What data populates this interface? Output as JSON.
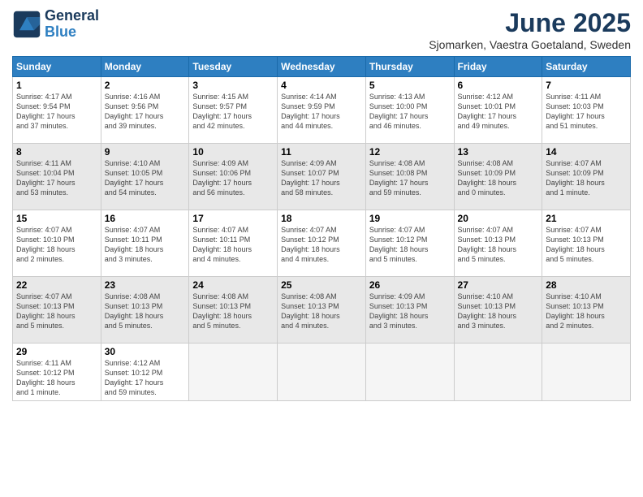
{
  "logo": {
    "line1": "General",
    "line2": "Blue"
  },
  "title": "June 2025",
  "subtitle": "Sjomarken, Vaestra Goetaland, Sweden",
  "days_of_week": [
    "Sunday",
    "Monday",
    "Tuesday",
    "Wednesday",
    "Thursday",
    "Friday",
    "Saturday"
  ],
  "weeks": [
    [
      {
        "day": "1",
        "info": "Sunrise: 4:17 AM\nSunset: 9:54 PM\nDaylight: 17 hours\nand 37 minutes.",
        "shaded": false
      },
      {
        "day": "2",
        "info": "Sunrise: 4:16 AM\nSunset: 9:56 PM\nDaylight: 17 hours\nand 39 minutes.",
        "shaded": false
      },
      {
        "day": "3",
        "info": "Sunrise: 4:15 AM\nSunset: 9:57 PM\nDaylight: 17 hours\nand 42 minutes.",
        "shaded": false
      },
      {
        "day": "4",
        "info": "Sunrise: 4:14 AM\nSunset: 9:59 PM\nDaylight: 17 hours\nand 44 minutes.",
        "shaded": false
      },
      {
        "day": "5",
        "info": "Sunrise: 4:13 AM\nSunset: 10:00 PM\nDaylight: 17 hours\nand 46 minutes.",
        "shaded": false
      },
      {
        "day": "6",
        "info": "Sunrise: 4:12 AM\nSunset: 10:01 PM\nDaylight: 17 hours\nand 49 minutes.",
        "shaded": false
      },
      {
        "day": "7",
        "info": "Sunrise: 4:11 AM\nSunset: 10:03 PM\nDaylight: 17 hours\nand 51 minutes.",
        "shaded": false
      }
    ],
    [
      {
        "day": "8",
        "info": "Sunrise: 4:11 AM\nSunset: 10:04 PM\nDaylight: 17 hours\nand 53 minutes.",
        "shaded": true
      },
      {
        "day": "9",
        "info": "Sunrise: 4:10 AM\nSunset: 10:05 PM\nDaylight: 17 hours\nand 54 minutes.",
        "shaded": true
      },
      {
        "day": "10",
        "info": "Sunrise: 4:09 AM\nSunset: 10:06 PM\nDaylight: 17 hours\nand 56 minutes.",
        "shaded": true
      },
      {
        "day": "11",
        "info": "Sunrise: 4:09 AM\nSunset: 10:07 PM\nDaylight: 17 hours\nand 58 minutes.",
        "shaded": true
      },
      {
        "day": "12",
        "info": "Sunrise: 4:08 AM\nSunset: 10:08 PM\nDaylight: 17 hours\nand 59 minutes.",
        "shaded": true
      },
      {
        "day": "13",
        "info": "Sunrise: 4:08 AM\nSunset: 10:09 PM\nDaylight: 18 hours\nand 0 minutes.",
        "shaded": true
      },
      {
        "day": "14",
        "info": "Sunrise: 4:07 AM\nSunset: 10:09 PM\nDaylight: 18 hours\nand 1 minute.",
        "shaded": true
      }
    ],
    [
      {
        "day": "15",
        "info": "Sunrise: 4:07 AM\nSunset: 10:10 PM\nDaylight: 18 hours\nand 2 minutes.",
        "shaded": false
      },
      {
        "day": "16",
        "info": "Sunrise: 4:07 AM\nSunset: 10:11 PM\nDaylight: 18 hours\nand 3 minutes.",
        "shaded": false
      },
      {
        "day": "17",
        "info": "Sunrise: 4:07 AM\nSunset: 10:11 PM\nDaylight: 18 hours\nand 4 minutes.",
        "shaded": false
      },
      {
        "day": "18",
        "info": "Sunrise: 4:07 AM\nSunset: 10:12 PM\nDaylight: 18 hours\nand 4 minutes.",
        "shaded": false
      },
      {
        "day": "19",
        "info": "Sunrise: 4:07 AM\nSunset: 10:12 PM\nDaylight: 18 hours\nand 5 minutes.",
        "shaded": false
      },
      {
        "day": "20",
        "info": "Sunrise: 4:07 AM\nSunset: 10:13 PM\nDaylight: 18 hours\nand 5 minutes.",
        "shaded": false
      },
      {
        "day": "21",
        "info": "Sunrise: 4:07 AM\nSunset: 10:13 PM\nDaylight: 18 hours\nand 5 minutes.",
        "shaded": false
      }
    ],
    [
      {
        "day": "22",
        "info": "Sunrise: 4:07 AM\nSunset: 10:13 PM\nDaylight: 18 hours\nand 5 minutes.",
        "shaded": true
      },
      {
        "day": "23",
        "info": "Sunrise: 4:08 AM\nSunset: 10:13 PM\nDaylight: 18 hours\nand 5 minutes.",
        "shaded": true
      },
      {
        "day": "24",
        "info": "Sunrise: 4:08 AM\nSunset: 10:13 PM\nDaylight: 18 hours\nand 5 minutes.",
        "shaded": true
      },
      {
        "day": "25",
        "info": "Sunrise: 4:08 AM\nSunset: 10:13 PM\nDaylight: 18 hours\nand 4 minutes.",
        "shaded": true
      },
      {
        "day": "26",
        "info": "Sunrise: 4:09 AM\nSunset: 10:13 PM\nDaylight: 18 hours\nand 3 minutes.",
        "shaded": true
      },
      {
        "day": "27",
        "info": "Sunrise: 4:10 AM\nSunset: 10:13 PM\nDaylight: 18 hours\nand 3 minutes.",
        "shaded": true
      },
      {
        "day": "28",
        "info": "Sunrise: 4:10 AM\nSunset: 10:13 PM\nDaylight: 18 hours\nand 2 minutes.",
        "shaded": true
      }
    ],
    [
      {
        "day": "29",
        "info": "Sunrise: 4:11 AM\nSunset: 10:12 PM\nDaylight: 18 hours\nand 1 minute.",
        "shaded": false
      },
      {
        "day": "30",
        "info": "Sunrise: 4:12 AM\nSunset: 10:12 PM\nDaylight: 17 hours\nand 59 minutes.",
        "shaded": false
      },
      {
        "day": "",
        "info": "",
        "shaded": false,
        "empty": true
      },
      {
        "day": "",
        "info": "",
        "shaded": false,
        "empty": true
      },
      {
        "day": "",
        "info": "",
        "shaded": false,
        "empty": true
      },
      {
        "day": "",
        "info": "",
        "shaded": false,
        "empty": true
      },
      {
        "day": "",
        "info": "",
        "shaded": false,
        "empty": true
      }
    ]
  ]
}
